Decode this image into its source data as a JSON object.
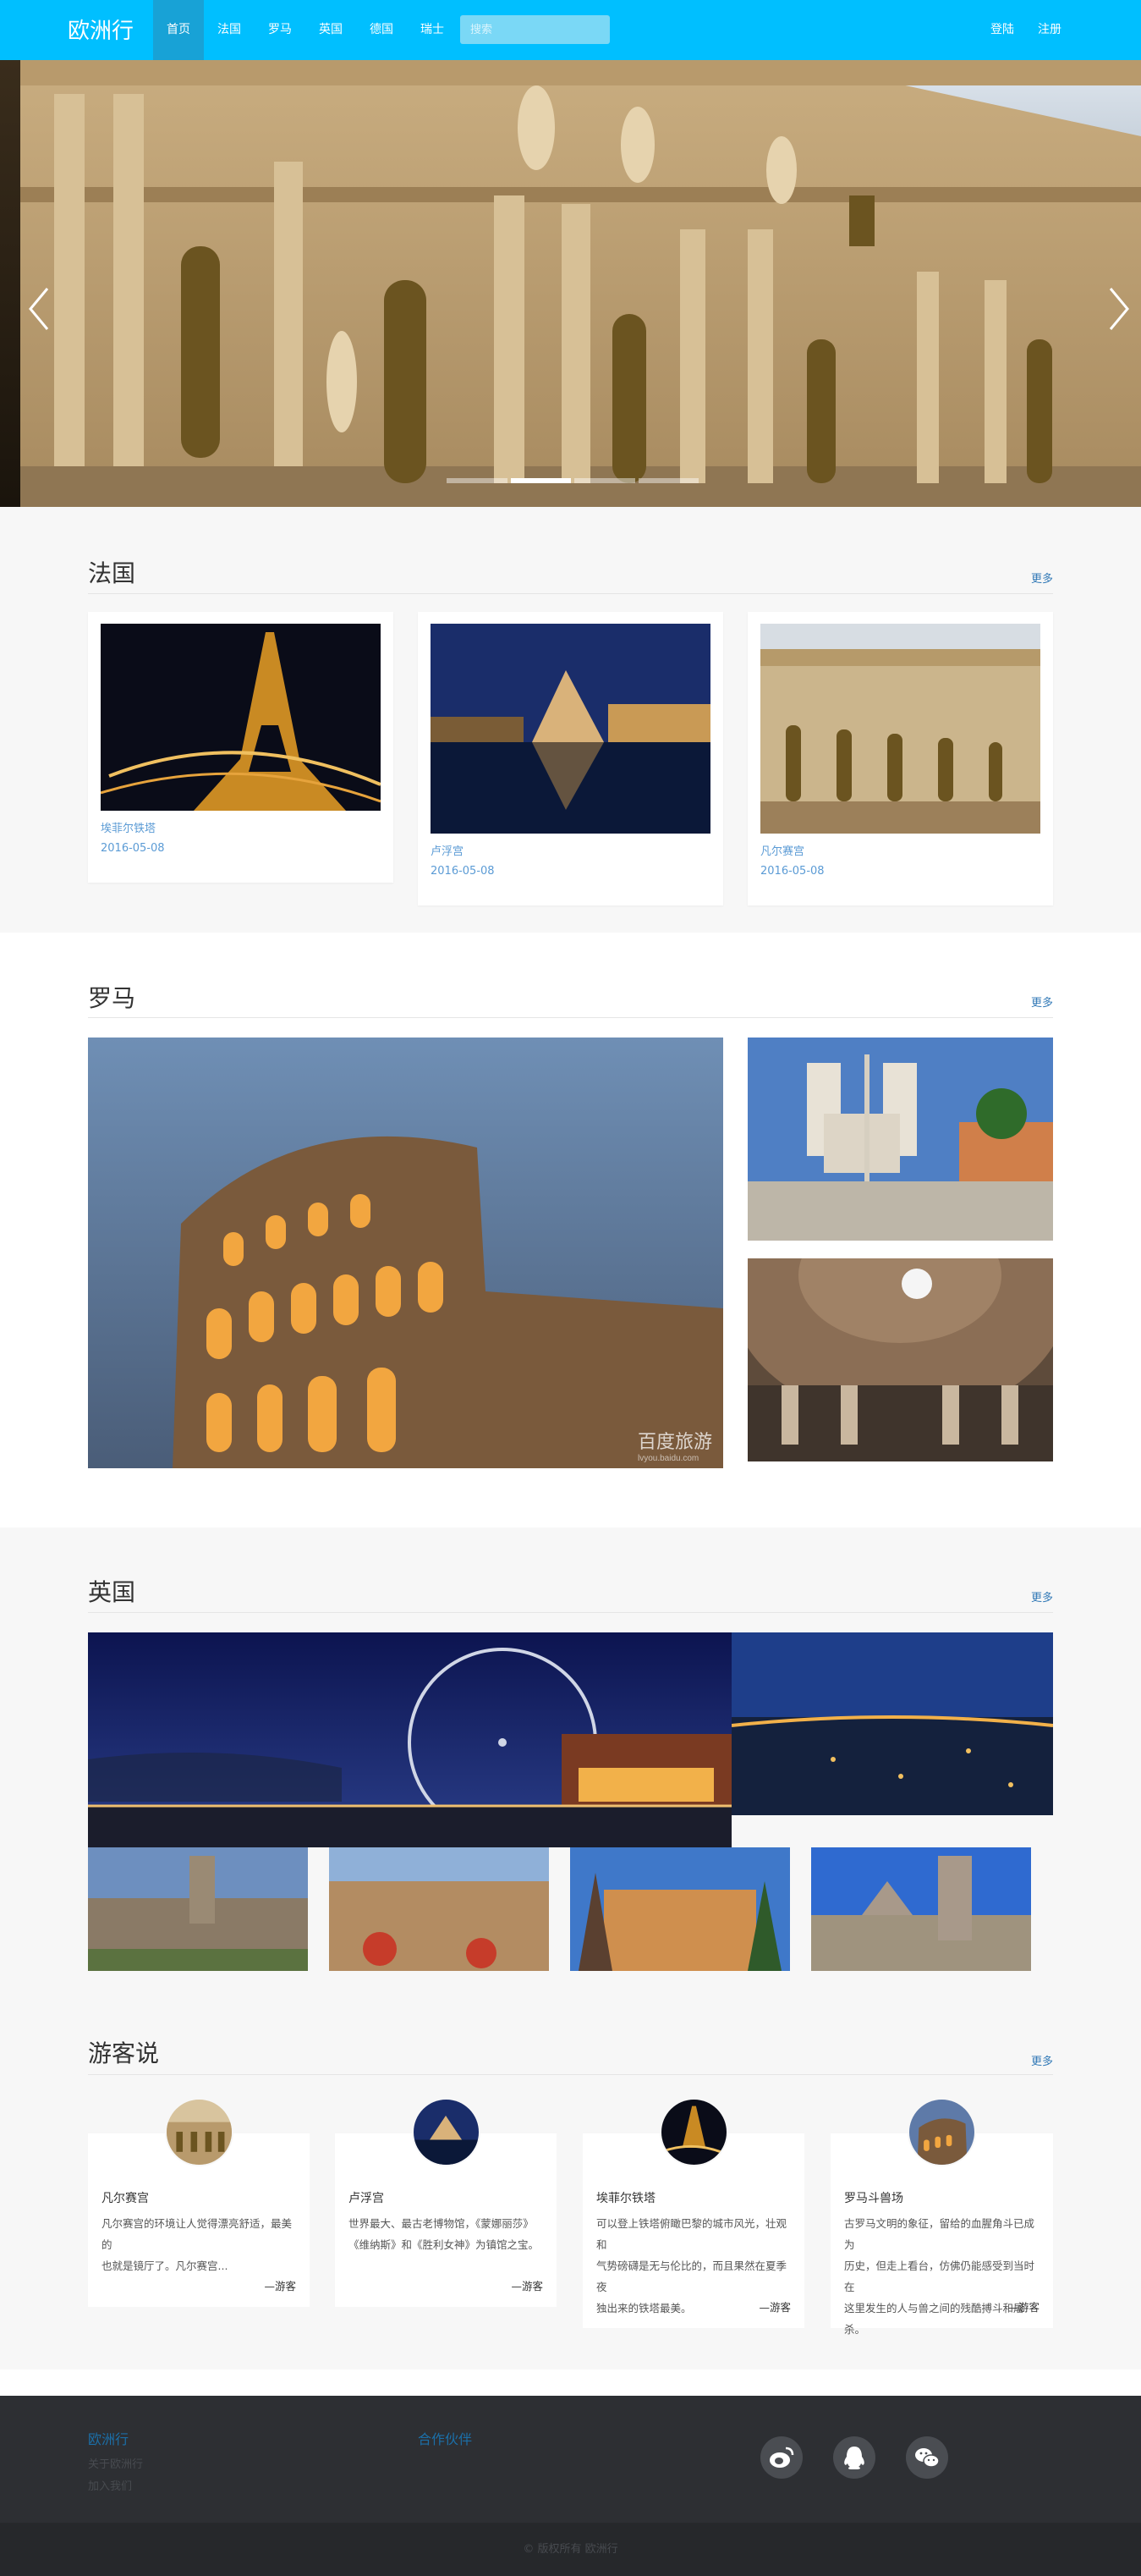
{
  "nav": {
    "brand": "欧洲行",
    "items": [
      {
        "label": "首页",
        "active": true
      },
      {
        "label": "法国",
        "active": false
      },
      {
        "label": "罗马",
        "active": false
      },
      {
        "label": "英国",
        "active": false
      },
      {
        "label": "德国",
        "active": false
      },
      {
        "label": "瑞士",
        "active": false
      }
    ],
    "search_placeholder": "搜索",
    "login": "登陆",
    "register": "注册",
    "accent": "#00BFFF"
  },
  "carousel": {
    "slide_count": 4,
    "active_index": 1,
    "prev_icon": "chevron-left-icon",
    "next_icon": "chevron-right-icon"
  },
  "france": {
    "title": "法国",
    "more": "更多",
    "cards": [
      {
        "caption": "埃菲尔铁塔",
        "date": "2016-05-08"
      },
      {
        "caption": "卢浮宫",
        "date": "2016-05-08"
      },
      {
        "caption": "凡尔赛宫",
        "date": "2016-05-08"
      }
    ]
  },
  "rome": {
    "title": "罗马",
    "more": "更多",
    "watermark": "百度旅游",
    "watermark_url": "lvyou.baidu.com"
  },
  "uk": {
    "title": "英国",
    "more": "更多"
  },
  "reviews": {
    "title": "游客说",
    "more": "更多",
    "items": [
      {
        "name": "凡尔赛宫",
        "lines": [
          "凡尔赛宫的环境让人觉得漂亮舒适，最美的",
          "也就是镜厅了。凡尔赛宫..."
        ],
        "sign": "—游客"
      },
      {
        "name": "卢浮宫",
        "lines": [
          "世界最大、最古老博物馆，《蒙娜丽莎》",
          "《维纳斯》和《胜利女神》为镇馆之宝。"
        ],
        "sign": "—游客"
      },
      {
        "name": "埃菲尔铁塔",
        "lines": [
          "可以登上铁塔俯瞰巴黎的城市风光，壮观和",
          "气势磅礴是无与伦比的，而且果然在夏季夜",
          "独出来的铁塔最美。"
        ],
        "sign": "—游客"
      },
      {
        "name": "罗马斗兽场",
        "lines": [
          "古罗马文明的象征，留给的血腥角斗已成为",
          "历史，但走上看台，仿佛仍能感受到当时在",
          "这里发生的人与兽之间的残酷搏斗和屠杀。"
        ],
        "sign": "—游客"
      }
    ]
  },
  "footer": {
    "col1_title": "欧洲行",
    "col1_links": [
      "关于欧洲行",
      "加入我们"
    ],
    "col2_title": "合作伙伴",
    "social": [
      "weibo-icon",
      "qq-icon",
      "wechat-icon"
    ],
    "copyright": "© 版权所有 欧洲行"
  }
}
